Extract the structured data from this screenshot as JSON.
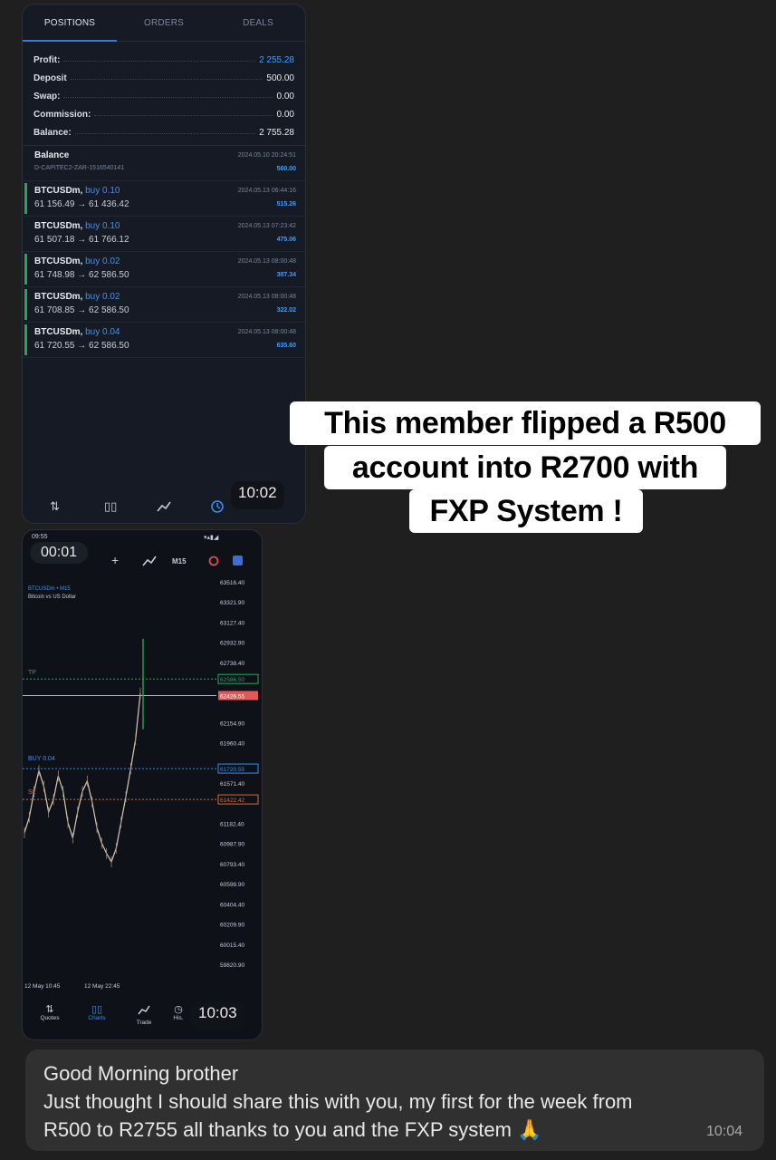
{
  "history_screen": {
    "tabs": [
      "POSITIONS",
      "ORDERS",
      "DEALS"
    ],
    "summary": [
      {
        "label": "Profit:",
        "value": "2 255.28"
      },
      {
        "label": "Deposit",
        "value": "500.00"
      },
      {
        "label": "Swap:",
        "value": "0.00"
      },
      {
        "label": "Commission:",
        "value": "0.00"
      },
      {
        "label": "Balance:",
        "value": "2 755.28"
      }
    ],
    "balance_entry": {
      "title": "Balance",
      "account": "D-CAPITEC2-ZAR-1516540141",
      "date": "2024.05.10 20:24:51",
      "amount": "500.00"
    },
    "deals": [
      {
        "symbol": "BTCUSDm,",
        "side": "buy 0.10",
        "prices": "61 156.49 → 61 436.42",
        "date": "2024.05.13 06:44:16",
        "profit": "515.26"
      },
      {
        "symbol": "BTCUSDm,",
        "side": "buy 0.10",
        "prices": "61 507.18 → 61 766.12",
        "date": "2024.05.13 07:23:42",
        "profit": "475.06"
      },
      {
        "symbol": "BTCUSDm,",
        "side": "buy 0.02",
        "prices": "61 748.98 → 62 586.50",
        "date": "2024.05.13 08:00:48",
        "profit": "307.34"
      },
      {
        "symbol": "BTCUSDm,",
        "side": "buy 0.02",
        "prices": "61 708.85 → 62 586.50",
        "date": "2024.05.13 08:00:48",
        "profit": "322.02"
      },
      {
        "symbol": "BTCUSDm,",
        "side": "buy 0.04",
        "prices": "61 720.55 → 62 586.50",
        "date": "2024.05.13 08:00:48",
        "profit": "635.60"
      }
    ],
    "nav_icons": [
      "quotes-icon",
      "charts-icon",
      "trade-icon",
      "history-icon"
    ],
    "accent_color": "#2f7ee0"
  },
  "history_timestamp": "10:02",
  "caption": {
    "lines": [
      "This member flipped a R500",
      "account into R2700 with",
      "FXP System !"
    ]
  },
  "chart_screen": {
    "status_time": "09:55",
    "timer": "00:01",
    "timeframe": "M15",
    "symbol_line": "BTCUSDm • M15",
    "symbol_desc": "Bitcoin vs US Dollar",
    "tp_label": "TP",
    "buy_label": "BUY 0.04",
    "sl_label": "SL",
    "x_labels": [
      "12 May 10:45",
      "12 May 22:45"
    ],
    "nav": [
      "Quotes",
      "Charts",
      "Trade",
      "His."
    ],
    "line_colors": {
      "tp": "#2aa35a",
      "buy": "#3b8ee8",
      "sl": "#e06a2a"
    }
  },
  "chart_data": {
    "type": "line",
    "title": "BTCUSDm • M15",
    "subtitle": "Bitcoin vs US Dollar",
    "y_ticks": [
      63516.4,
      63321.9,
      63127.4,
      62932.9,
      62738.4,
      62154.9,
      61960.4,
      61571.4,
      61182.4,
      60987.9,
      60793.4,
      60598.9,
      60404.4,
      60209.9,
      60015.4,
      59820.9
    ],
    "ylim": [
      59820.9,
      63516.4
    ],
    "x_tick_labels": [
      "12 May 10:45",
      "12 May 22:45"
    ],
    "levels": {
      "tp": 62586.5,
      "bid": 62426.55,
      "buy": 61720.55,
      "sl": 61422.42
    },
    "series": [
      {
        "values": [
          61100,
          61250,
          61500,
          61700,
          61550,
          61300,
          61420,
          61650,
          61500,
          61200,
          61050,
          61300,
          61500,
          61600,
          61400,
          61150,
          61000,
          60900,
          60820,
          60950,
          61200,
          61450,
          61720,
          62000,
          62450
        ]
      }
    ],
    "grid": false
  },
  "chart_timestamp": "10:03",
  "message": {
    "lines": [
      "Good Morning brother",
      "Just thought I should share this with you, my first for the week from",
      "R500 to R2755 all thanks to you and the FXP system 🙏"
    ],
    "time": "10:04"
  }
}
